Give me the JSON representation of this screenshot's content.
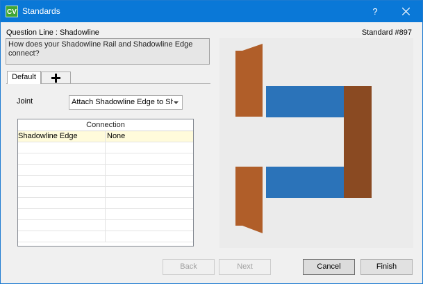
{
  "window": {
    "title": "Standards",
    "app_icon_text": "CV",
    "help_label": "?"
  },
  "header": {
    "question_line": "Question Line : Shadowline",
    "standard_number": "Standard #897"
  },
  "question": {
    "text": "How does your Shadowline Rail and Shadowline Edge connect?"
  },
  "tabs": [
    {
      "label": "Default",
      "selected": true
    }
  ],
  "joint": {
    "label": "Joint",
    "value": "Attach Shadowline Edge to Sh"
  },
  "connection_table": {
    "header": "Connection",
    "rows": [
      {
        "part": "Shadowline Edge",
        "value": "None"
      }
    ]
  },
  "preview": {
    "colors": {
      "background": "#ebebeb",
      "wood_light": "#b05e29",
      "wood_dark": "#8a4a22",
      "blue": "#2b73b9"
    }
  },
  "buttons": {
    "back": "Back",
    "next": "Next",
    "cancel": "Cancel",
    "finish": "Finish"
  }
}
